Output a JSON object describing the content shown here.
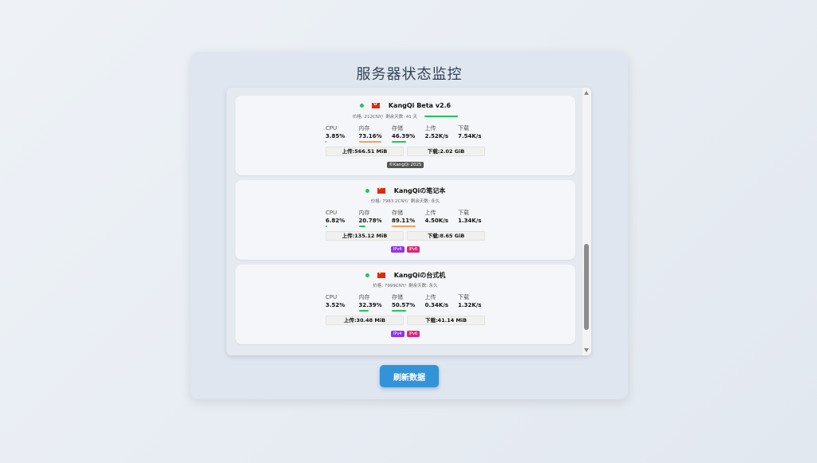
{
  "page": {
    "title": "服务器状态监控",
    "refresh_label": "刷新数据"
  },
  "labels": {
    "cpu": "CPU",
    "mem": "内存",
    "disk": "存储",
    "up": "上传",
    "down": "下载"
  },
  "colors": {
    "online": "#22c55e",
    "bar_low": "#22c55e",
    "bar_high": "#f6a15a",
    "button": "#3393d9"
  },
  "servers": [
    {
      "name": "KangQi Beta v2.6",
      "flag": "hk-flag",
      "price": "价格: 212CNY/",
      "days": "剩余天数: 41 天",
      "cpu": "3.85%",
      "mem": "73.16%",
      "disk": "46.39%",
      "up_speed": "2.52K/s",
      "down_speed": "7.54K/s",
      "up_total": "上传:566.51 MiB",
      "down_total": "下载:2.02 GiB",
      "copyright": "©KangQi 2025"
    },
    {
      "name": "KangQiの笔记本",
      "flag": "cn-flag",
      "price": "价格: 7983.2CNY/",
      "days": "剩余天数: 永久",
      "cpu": "6.82%",
      "mem": "20.78%",
      "disk": "89.11%",
      "up_speed": "4.50K/s",
      "down_speed": "1.34K/s",
      "up_total": "上传:135.12 MiB",
      "down_total": "下载:8.65 GiB",
      "ipv4": "IPv4",
      "ipv6": "IPv6"
    },
    {
      "name": "KangQiの台式机",
      "flag": "cn-flag",
      "price": "价格: 7999CNY/",
      "days": "剩余天数: 永久",
      "cpu": "3.52%",
      "mem": "32.39%",
      "disk": "50.57%",
      "up_speed": "0.34K/s",
      "down_speed": "1.32K/s",
      "up_total": "上传:30.48 MiB",
      "down_total": "下载:41.14 MiB",
      "ipv4": "IPv4",
      "ipv6": "IPv6"
    }
  ]
}
